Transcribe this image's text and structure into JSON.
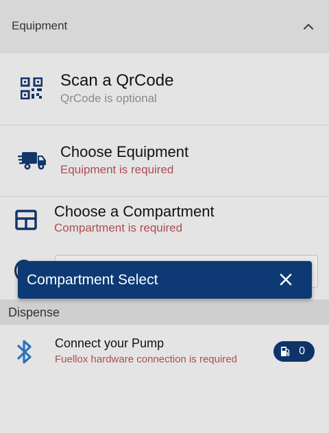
{
  "equipment_section": {
    "title": "Equipment"
  },
  "rows": [
    {
      "title": "Scan a QrCode",
      "subtitle": "QrCode is optional",
      "icon": "qrcode-icon"
    },
    {
      "title": "Choose Equipment",
      "subtitle": "Equipment is required",
      "icon": "truck-icon"
    },
    {
      "title": "Choose a Compartment",
      "subtitle": "Compartment is required",
      "icon": "grid-icon"
    }
  ],
  "dispense_section": {
    "title": "Dispense"
  },
  "pump": {
    "title": "Connect your Pump",
    "subtitle": "Fuellox hardware connection is required",
    "icon": "bluetooth-icon",
    "badge_count": "0",
    "badge_icon": "fuel-pump-icon"
  },
  "snackbar": {
    "message": "Compartment Select",
    "close_icon": "close-icon"
  },
  "colors": {
    "primary": "#0d3a75",
    "error_text": "#b04b4f",
    "muted_text": "#8a8a8a",
    "bluetooth": "#2a73b8"
  }
}
